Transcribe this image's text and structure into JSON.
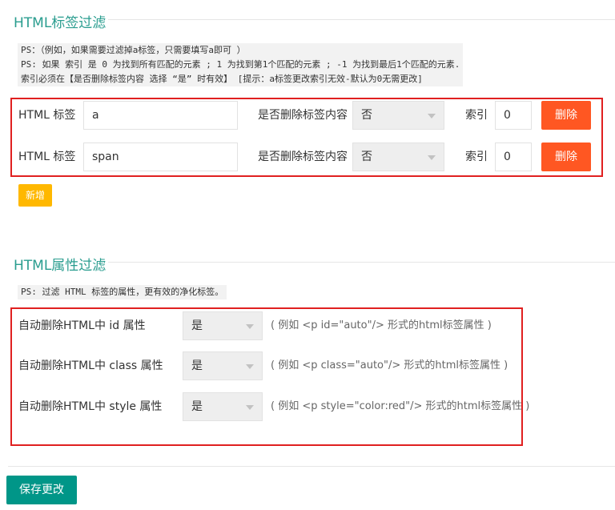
{
  "tag_filter": {
    "title": "HTML标签过滤",
    "ps_lines": [
      "PS：（例如，如果需要过滤掉a标签，只需要填写a即可 ）",
      "PS: 如果 索引 是 0 为找到所有匹配的元素 ; 1 为找到第1个匹配的元素 ; -1 为找到最后1个匹配的元素.",
      "索引必须在【是否删除标签内容 选择 “是” 时有效】 [提示：a标签更改索引无效-默认为0无需更改]"
    ],
    "rows": [
      {
        "tag_label": "HTML 标签",
        "tag_value": "a",
        "delete_content_label": "是否删除标签内容",
        "delete_content_value": "否",
        "index_label": "索引",
        "index_value": "0",
        "delete_button": "删除"
      },
      {
        "tag_label": "HTML 标签",
        "tag_value": "span",
        "delete_content_label": "是否删除标签内容",
        "delete_content_value": "否",
        "index_label": "索引",
        "index_value": "0",
        "delete_button": "删除"
      }
    ],
    "add_button": "新增"
  },
  "attr_filter": {
    "title": "HTML属性过滤",
    "ps_line": "PS: 过滤 HTML 标签的属性，更有效的净化标签。",
    "rows": [
      {
        "label": "自动删除HTML中 id 属性",
        "value": "是",
        "hint": "( 例如 <p id=\"auto\"/> 形式的html标签属性 )"
      },
      {
        "label": "自动删除HTML中 class 属性",
        "value": "是",
        "hint": "( 例如 <p class=\"auto\"/> 形式的html标签属性 )"
      },
      {
        "label": "自动删除HTML中 style 属性",
        "value": "是",
        "hint": "( 例如 <p style=\"color:red\"/> 形式的html标签属性 )"
      }
    ]
  },
  "save_button": "保存更改",
  "colors": {
    "title_teal": "#2a9d8f",
    "danger": "#ff5722",
    "warn": "#ffb800",
    "primary": "#009688",
    "highlight_border": "#e02020"
  },
  "icons": {
    "select_caret": "chevron-down-icon"
  }
}
